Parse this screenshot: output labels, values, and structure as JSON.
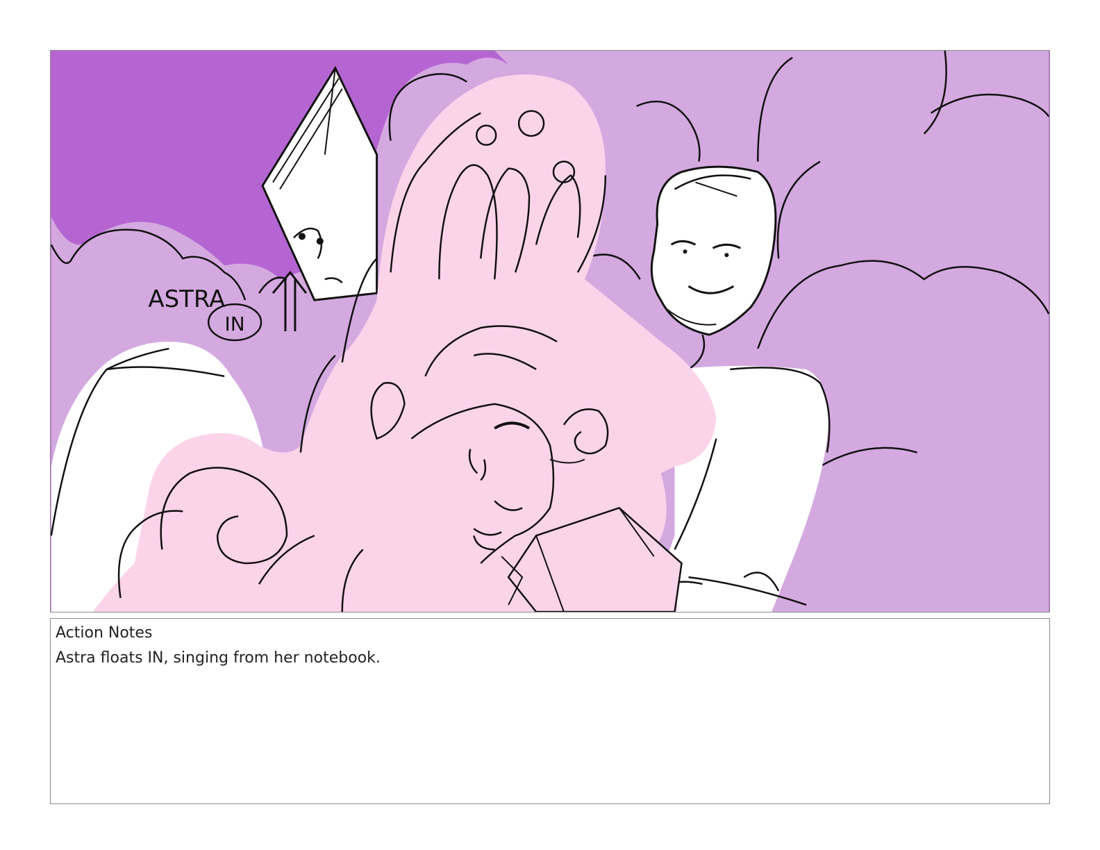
{
  "panel": {
    "image_name": "storyboard-panel-sketch",
    "annotation": {
      "name_text": "ASTRA",
      "direction_text": "IN"
    },
    "colors": {
      "background_purple": "#b565d2",
      "cloud_lavender": "#d4a9e0",
      "character_pink": "#fbd4ea",
      "outline": "#111111"
    }
  },
  "notes": {
    "heading": "Action Notes",
    "body": "Astra floats IN, singing from her notebook."
  }
}
